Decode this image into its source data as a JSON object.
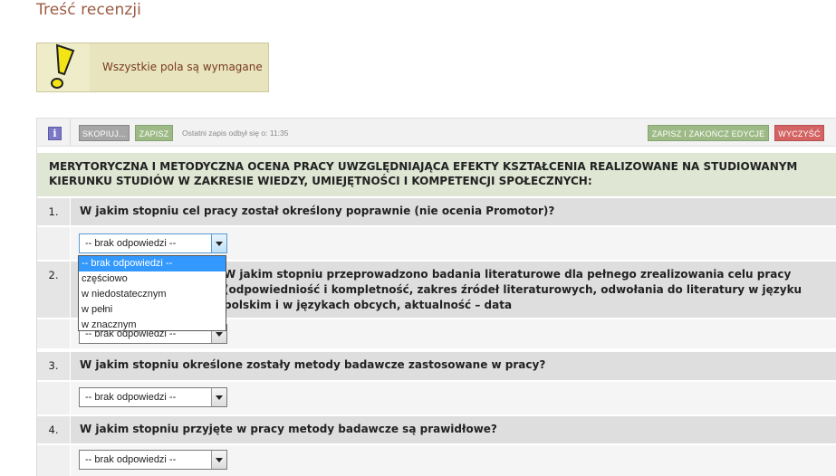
{
  "page": {
    "title": "Treść recenzji"
  },
  "notice": {
    "text": "Wszystkie pola są wymagane",
    "icon": "warning-exclamation-icon"
  },
  "toolbar": {
    "info_label": "i",
    "copy_label": "SKOPIUJ...",
    "save_label": "ZAPISZ",
    "last_save_text": "Ostatni zapis odbył się o: 11:35",
    "finish_label": "ZAPISZ I ZAKOŃCZ EDYCJE",
    "clear_label": "WYCZYŚĆ"
  },
  "section": {
    "title": "MERYTORYCZNA I METODYCZNA OCENA PRACY UWZGLĘDNIAJĄCA EFEKTY KSZTAŁCENIA REALIZOWANE NA STUDIOWANYM KIERUNKU STUDIÓW W ZAKRESIE WIEDZY, UMIEJĘTNOŚCI I KOMPETENCJI SPOŁECZNYCH:"
  },
  "questions": [
    {
      "num": "1.",
      "text": "W jakim stopniu cel pracy został określony poprawnie (nie ocenia Promotor)?",
      "answer": "-- brak odpowiedzi --"
    },
    {
      "num": "2.",
      "text": "W jakim stopniu przeprowadzono badania literaturowe dla pełnego zrealizowania celu pracy (odpowiedniość i kompletność, zakres źródeł literaturowych, odwołania do literatury w języku polskim i w językach obcych, aktualność – data",
      "answer": "-- brak odpowiedzi --"
    },
    {
      "num": "3.",
      "text": "W jakim stopniu określone zostały metody badawcze zastosowane w pracy?",
      "answer": "-- brak odpowiedzi --"
    },
    {
      "num": "4.",
      "text": "W jakim stopniu przyjęte w pracy metody badawcze są prawidłowe?",
      "answer": "-- brak odpowiedzi --"
    }
  ],
  "dropdown_options": [
    "-- brak odpowiedzi --",
    "częściowo",
    "w niedostatecznym",
    "w pełni",
    "w znacznym"
  ],
  "colors": {
    "title": "#9b5a42",
    "notice_bg": "#e7e4be",
    "save_green": "#9dba86",
    "clear_red": "#d46464",
    "section_bg": "#dfe6d4",
    "option_highlight": "#3399ff"
  }
}
